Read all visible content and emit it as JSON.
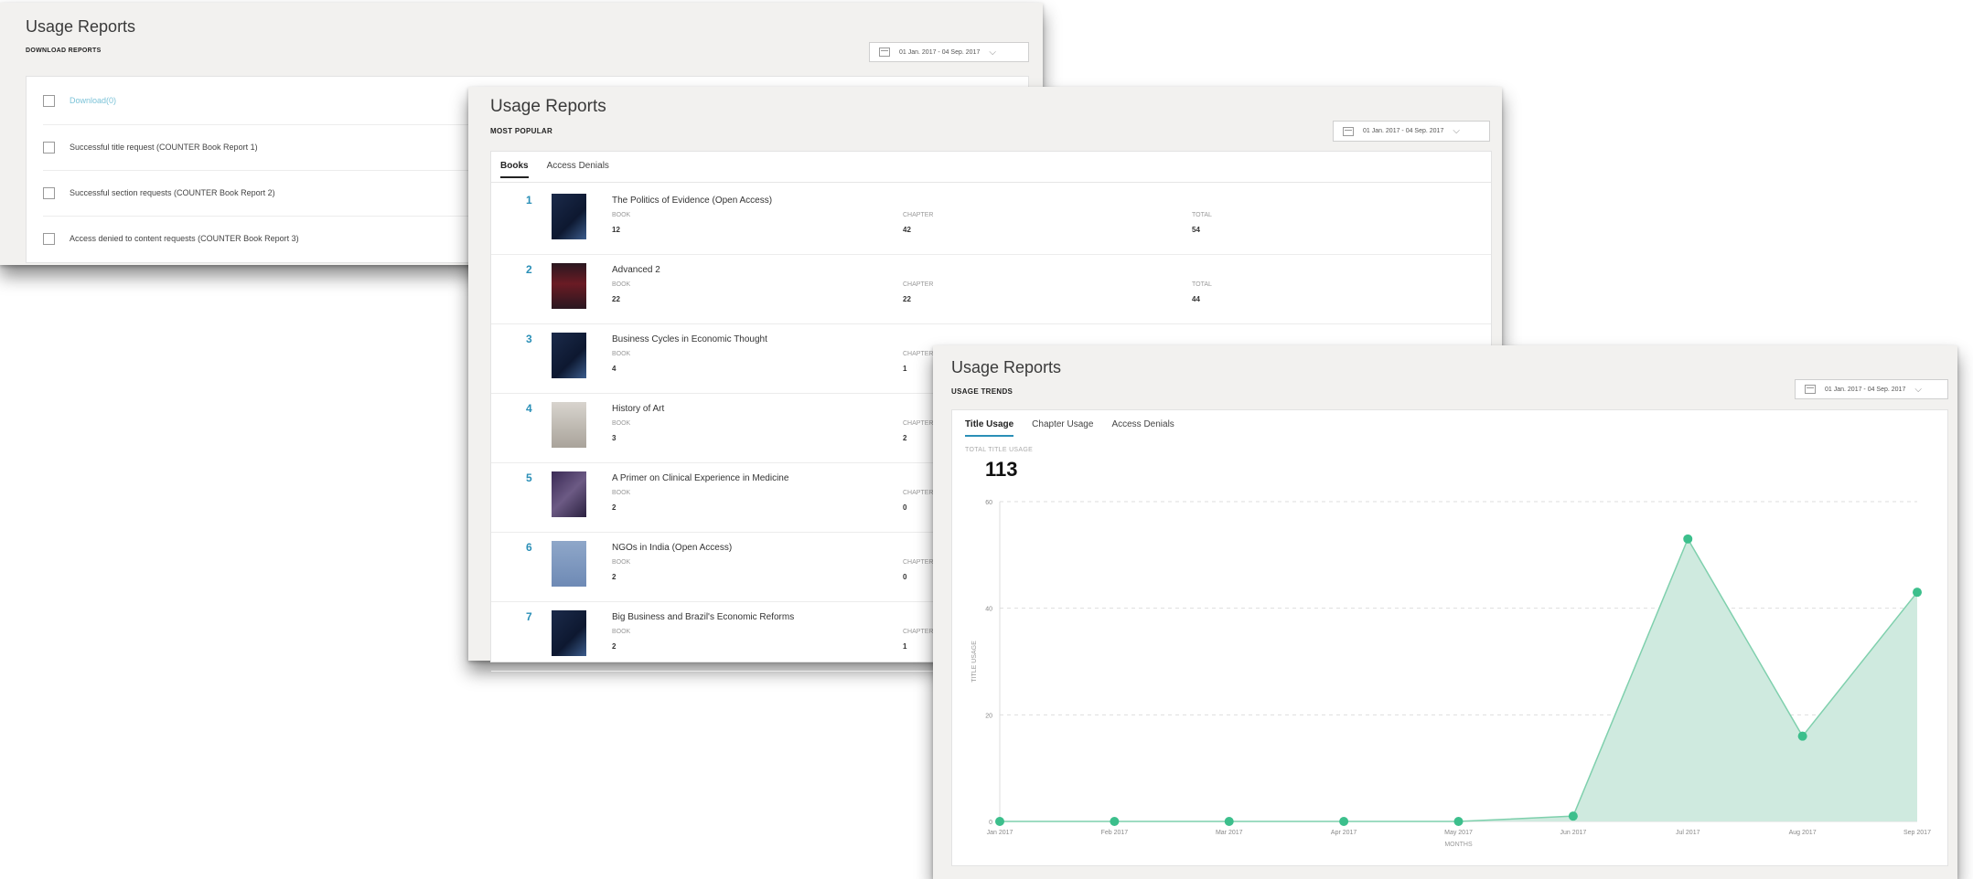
{
  "colors": {
    "accent": "#2a8fb7",
    "chart_fill": "#cfeadf",
    "chart_line": "#7fd0ad",
    "chart_dot": "#3cbf8c"
  },
  "download_panel": {
    "title": "Usage Reports",
    "section": "DOWNLOAD REPORTS",
    "date_range": "01 Jan. 2017 - 04 Sep. 2017",
    "download_link": "Download(0)",
    "reports": [
      "Successful title request (COUNTER Book Report 1)",
      "Successful section requests (COUNTER Book Report 2)",
      "Access denied to content requests (COUNTER Book Report 3)"
    ]
  },
  "popular_panel": {
    "title": "Usage Reports",
    "section": "MOST POPULAR",
    "date_range": "01 Jan. 2017 - 04 Sep. 2017",
    "tabs": [
      "Books",
      "Access Denials"
    ],
    "col_labels": {
      "book": "BOOK",
      "chapter": "CHAPTER",
      "total": "TOTAL"
    },
    "books": [
      {
        "rank": "1",
        "title": "The Politics of Evidence (Open Access)",
        "book": "12",
        "chapter": "42",
        "total": "54",
        "cover": "dark-blue"
      },
      {
        "rank": "2",
        "title": "Advanced 2",
        "book": "22",
        "chapter": "22",
        "total": "44",
        "cover": "dark-red"
      },
      {
        "rank": "3",
        "title": "Business Cycles in Economic Thought",
        "book": "4",
        "chapter": "1",
        "total": "",
        "cover": "dark-blue"
      },
      {
        "rank": "4",
        "title": "History of Art",
        "book": "3",
        "chapter": "2",
        "total": "",
        "cover": "grey"
      },
      {
        "rank": "5",
        "title": "A Primer on Clinical Experience in Medicine",
        "book": "2",
        "chapter": "0",
        "total": "",
        "cover": "purple"
      },
      {
        "rank": "6",
        "title": "NGOs in India (Open Access)",
        "book": "2",
        "chapter": "0",
        "total": "",
        "cover": "light-blue"
      },
      {
        "rank": "7",
        "title": "Big Business and Brazil's Economic Reforms",
        "book": "2",
        "chapter": "1",
        "total": "",
        "cover": "dark-blue"
      }
    ]
  },
  "trends_panel": {
    "title": "Usage Reports",
    "section": "USAGE TRENDS",
    "date_range": "01 Jan. 2017 - 04 Sep. 2017",
    "tabs": [
      "Title Usage",
      "Chapter Usage",
      "Access Denials"
    ],
    "total_label": "TOTAL TITLE USAGE",
    "total_value": "113"
  },
  "chart_data": {
    "type": "area",
    "categories": [
      "Jan 2017",
      "Feb 2017",
      "Mar 2017",
      "Apr 2017",
      "May 2017",
      "Jun 2017",
      "Jul 2017",
      "Aug 2017",
      "Sep 2017"
    ],
    "values": [
      0,
      0,
      0,
      0,
      0,
      1,
      53,
      16,
      43
    ],
    "xlabel": "MONTHS",
    "ylabel": "TITLE USAGE",
    "yticks": [
      "0",
      "20",
      "40",
      "60"
    ],
    "ylim": [
      0,
      60
    ],
    "grid": true
  }
}
